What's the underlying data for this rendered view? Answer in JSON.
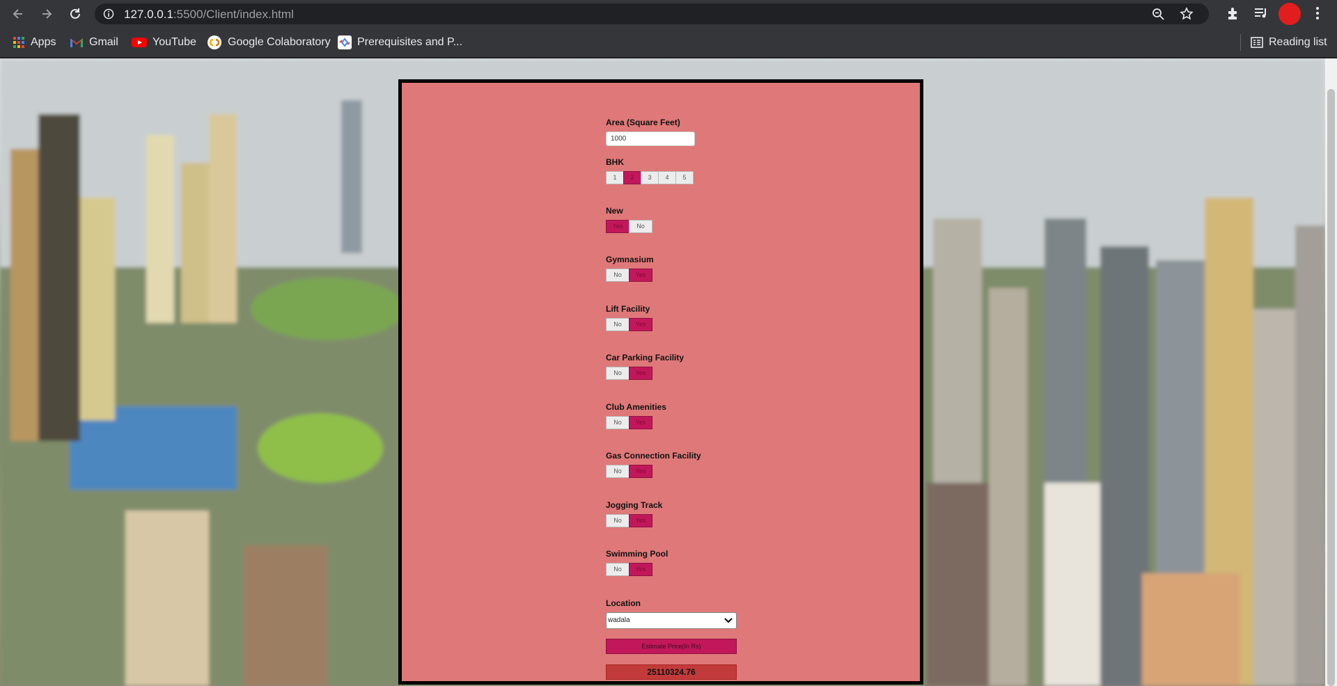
{
  "browser": {
    "url_host": "127.0.0.1",
    "url_rest": ":5500/Client/index.html",
    "bookmarks": [
      {
        "label": "Apps"
      },
      {
        "label": "Gmail"
      },
      {
        "label": "YouTube"
      },
      {
        "label": "Google Colaboratory"
      },
      {
        "label": "Prerequisites and P..."
      }
    ],
    "reading_list": "Reading list"
  },
  "form": {
    "area": {
      "label": "Area (Square Feet)",
      "value": "1000"
    },
    "bhk": {
      "label": "BHK",
      "options": [
        "1",
        "2",
        "3",
        "4",
        "5"
      ],
      "selected": "2"
    },
    "new": {
      "label": "New",
      "options": [
        "Yes",
        "No"
      ],
      "selected": "Yes"
    },
    "gymnasium": {
      "label": "Gymnasium",
      "options": [
        "No",
        "Yes"
      ],
      "selected": "Yes"
    },
    "lift": {
      "label": "Lift Facility",
      "options": [
        "No",
        "Yes"
      ],
      "selected": "Yes"
    },
    "parking": {
      "label": "Car Parking Facility",
      "options": [
        "No",
        "Yes"
      ],
      "selected": "Yes"
    },
    "club": {
      "label": "Club Amenities",
      "options": [
        "No",
        "Yes"
      ],
      "selected": "Yes"
    },
    "gas": {
      "label": "Gas Connection Facility",
      "options": [
        "No",
        "Yes"
      ],
      "selected": "Yes"
    },
    "jogging": {
      "label": "Jogging Track",
      "options": [
        "No",
        "Yes"
      ],
      "selected": "Yes"
    },
    "pool": {
      "label": "Swimming Pool",
      "options": [
        "No",
        "Yes"
      ],
      "selected": "Yes"
    },
    "location": {
      "label": "Location",
      "value": "wadala"
    },
    "estimate_label": "Estimate Price(In Rs)",
    "result": "25110324.76"
  },
  "colors": {
    "panel_bg": "#df7878",
    "selected_bg": "#c2185b",
    "result_bg": "#c23a3a"
  }
}
